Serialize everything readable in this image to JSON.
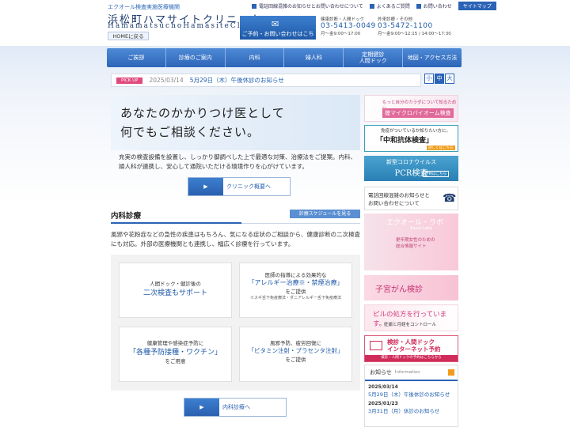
{
  "header": {
    "subtitle": "エクオール検査実施医療機関",
    "clinic_name": "浜松町ハマサイトクリニック",
    "clinic_roman": "HamamatsuchoHamasiteClinic",
    "home_label": "HOMEに戻る",
    "top_links": [
      "電話回線混雑のお知らせとお問い合わせについて",
      "よくあるご質問",
      "お問い合わせ",
      "サイトマップ"
    ],
    "reserve_label": "ご予約・お問い合わせはこちら",
    "tel_checkup": {
      "label": "健康診断・人間ドック",
      "number": "03-5413-0049",
      "hours": "月〜金9:00～17:00"
    },
    "tel_outpatient": {
      "label": "外来診療・その他",
      "number": "03-5472-1100",
      "hours": "月〜金9:00～12:15 / 14:00～17:30"
    }
  },
  "nav": [
    "ご挨拶",
    "診療のご案内",
    "内科",
    "婦人科",
    "定期健診\n人間ドック",
    "地図・アクセス方法"
  ],
  "pickup": {
    "tag": "PICK UP",
    "date": "2025/03/14",
    "title": "5月29日（木）午後休診のお知らせ"
  },
  "font_sizes": [
    "小",
    "中",
    "大"
  ],
  "hero": {
    "line1": "あなたのかかりつけ医として",
    "line2": "何でもご相談ください。"
  },
  "intro": "充実の検査設備を設置し、しっかり御調べした上で最適な対策、治療法をご提案。内科、婦人科が連携し、安心して通院いただける環境作りを心がけています。",
  "overview_button": "クリニック概要へ",
  "internal": {
    "heading": "内科診療",
    "schedule_button": "診療スケジュールを見る",
    "text": "風邪や花粉症などの急性の疾患はもちろん、気になる症状のご相談から、健康診断の二次検査にも対応。外部の医療機関とも連携し、幅広く診療を行っています。",
    "cards": [
      {
        "a": "人間ドック・健診後の",
        "b": "二次検査もサポート",
        "c": "",
        "d": ""
      },
      {
        "a": "医師の指導による効果的な",
        "b": "「アレルギー治療※・禁煙治療」",
        "c": "をご提供",
        "d": "※スギ舌下免疫療法・ダニアレルギー舌下免疫療法"
      },
      {
        "a": "健康管理や感染症予防に",
        "b": "「各種予防接種・ワクチン」",
        "c": "をご用意",
        "d": ""
      },
      {
        "a": "風邪予防、疲労回復に",
        "b": "「ビタミン注射・プラセンタ注射」",
        "c": "をご提供",
        "d": ""
      }
    ],
    "button": "内科診療へ"
  },
  "banners": {
    "micro": {
      "t1": "もっと自分のカラダについて知るために",
      "t2": "腟マイクロバイオーム検査"
    },
    "antibody": {
      "t1": "免疫がついているか知りたい方に。",
      "t2": "「中和抗体検査」",
      "t3": "詳しくはこちら"
    },
    "pcr": {
      "t1": "新型コロナウイルス",
      "t2": "PCR検査",
      "t3": "予約はこちら"
    },
    "tel": {
      "t1": "電話回線混雑のお知らせと",
      "t2": "お問い合わせについて"
    },
    "equol": {
      "t1": "エクオール・ラボ",
      "t2": "Equol Labo",
      "t3": "更年期女性のための",
      "t4": "総合情報サイト"
    },
    "cancer": {
      "t1": "子宮がん検診"
    },
    "pill": {
      "t1": "ピルの処方を行っています。",
      "t2": "妊娠と月経をコントロール"
    },
    "web": {
      "t1": "検診・人間ドック",
      "t2": "インターネット予約",
      "t3": "検診・人間ドックの予約はこちらから"
    }
  },
  "news": {
    "heading": "お知らせ",
    "heading_en": "Information",
    "items": [
      {
        "date": "2025/03/14",
        "title": "5月29日（木）午後休診のお知らせ"
      },
      {
        "date": "2025/01/23",
        "title": "3月31日（月）休診のお知らせ"
      }
    ]
  },
  "colors": {
    "brand_blue": "#2b63b6",
    "accent_pink": "#e04a7d"
  }
}
